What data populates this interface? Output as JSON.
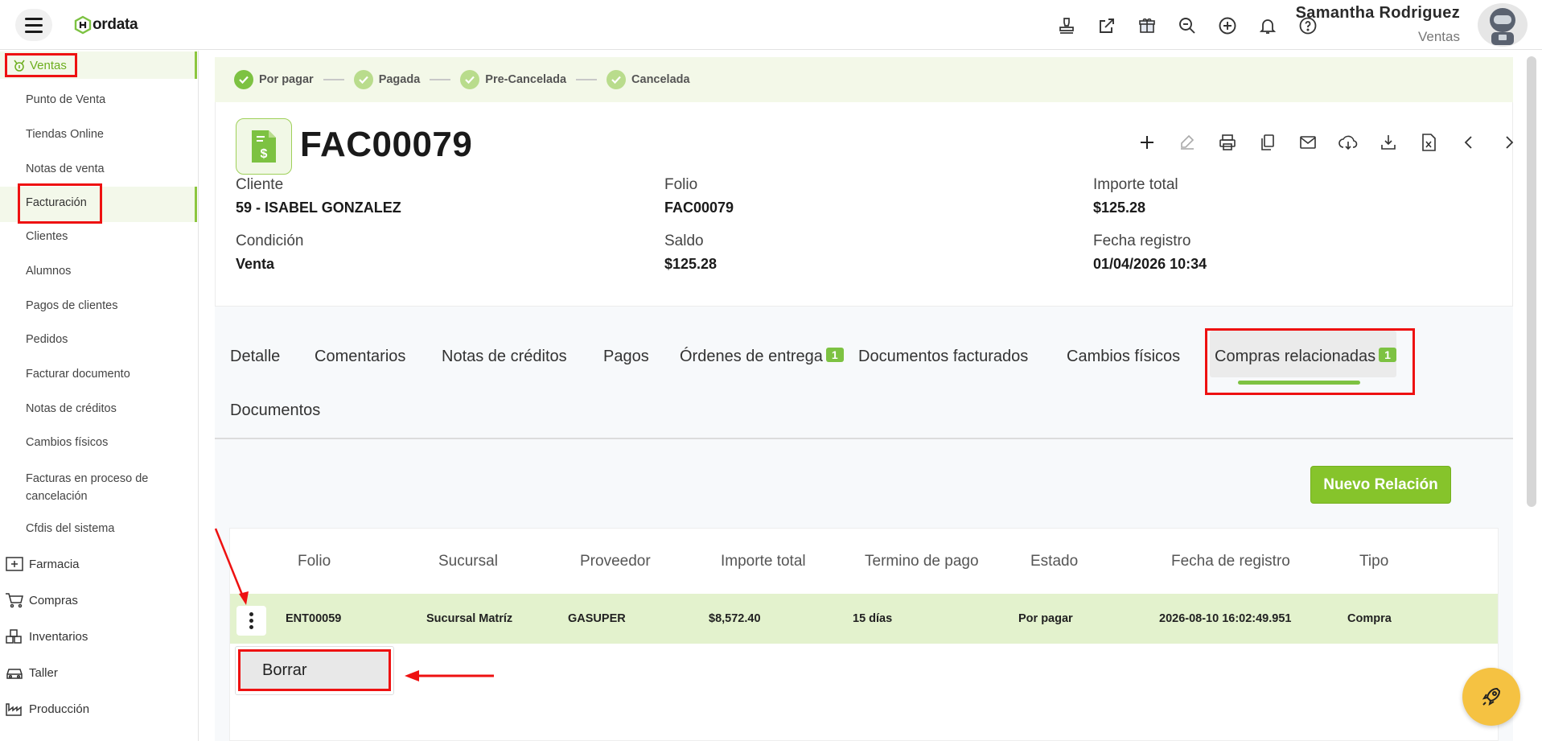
{
  "header": {
    "logo_text": "ordata",
    "user_name": "Samantha Rodriguez",
    "user_role": "Ventas",
    "icons": [
      "stamp-icon",
      "external-link-icon",
      "gift-icon",
      "search-icon",
      "add-circle-icon",
      "bell-icon",
      "help-icon"
    ]
  },
  "sidebar": {
    "section": "Ventas",
    "items": [
      "Punto de Venta",
      "Tiendas Online",
      "Notas de venta",
      "Facturación",
      "Clientes",
      "Alumnos",
      "Pagos de clientes",
      "Pedidos",
      "Facturar documento",
      "Notas de créditos",
      "Cambios físicos",
      "Facturas en proceso de cancelación",
      "Cfdis del sistema"
    ],
    "active_item": "Facturación",
    "groups": [
      "Farmacia",
      "Compras",
      "Inventarios",
      "Taller",
      "Producción"
    ]
  },
  "status": {
    "steps": [
      "Por pagar",
      "Pagada",
      "Pre-Cancelada",
      "Cancelada"
    ]
  },
  "document": {
    "title": "FAC00079",
    "fields": {
      "cliente_label": "Cliente",
      "cliente_value": "59 - ISABEL GONZALEZ",
      "folio_label": "Folio",
      "folio_value": "FAC00079",
      "importe_label": "Importe total",
      "importe_value": "$125.28",
      "condicion_label": "Condición",
      "condicion_value": "Venta",
      "saldo_label": "Saldo",
      "saldo_value": "$125.28",
      "fecha_label": "Fecha registro",
      "fecha_value": "01/04/2026 10:34"
    },
    "actions": [
      "add-icon",
      "edit-icon",
      "print-icon",
      "copy-icon",
      "mail-icon",
      "cloud-download-icon",
      "download-icon",
      "excel-icon",
      "prev-icon",
      "next-icon"
    ]
  },
  "tabs": {
    "detalle": "Detalle",
    "comentarios": "Comentarios",
    "notas": "Notas de créditos",
    "pagos": "Pagos",
    "ordenes": "Órdenes de entrega",
    "ordenes_badge": "1",
    "documentos_facturados": "Documentos facturados",
    "cambios": "Cambios físicos",
    "compras": "Compras relacionadas",
    "compras_badge": "1",
    "documentos": "Documentos",
    "active": "Compras relacionadas"
  },
  "content": {
    "new_button": "Nuevo Relación",
    "columns": [
      "Folio",
      "Sucursal",
      "Proveedor",
      "Importe total",
      "Termino de pago",
      "Estado",
      "Fecha de registro",
      "Tipo"
    ],
    "rows": [
      {
        "folio": "ENT00059",
        "sucursal": "Sucursal Matríz",
        "proveedor": "GASUPER",
        "importe": "$8,572.40",
        "termino": "15 días",
        "estado": "Por pagar",
        "fecha": "2026-08-10 16:02:49.951",
        "tipo": "Compra"
      }
    ],
    "menu_item": "Borrar"
  },
  "colors": {
    "accent_green": "#7dc242",
    "annotation_red": "#e11111",
    "fab_yellow": "#f5c242"
  }
}
